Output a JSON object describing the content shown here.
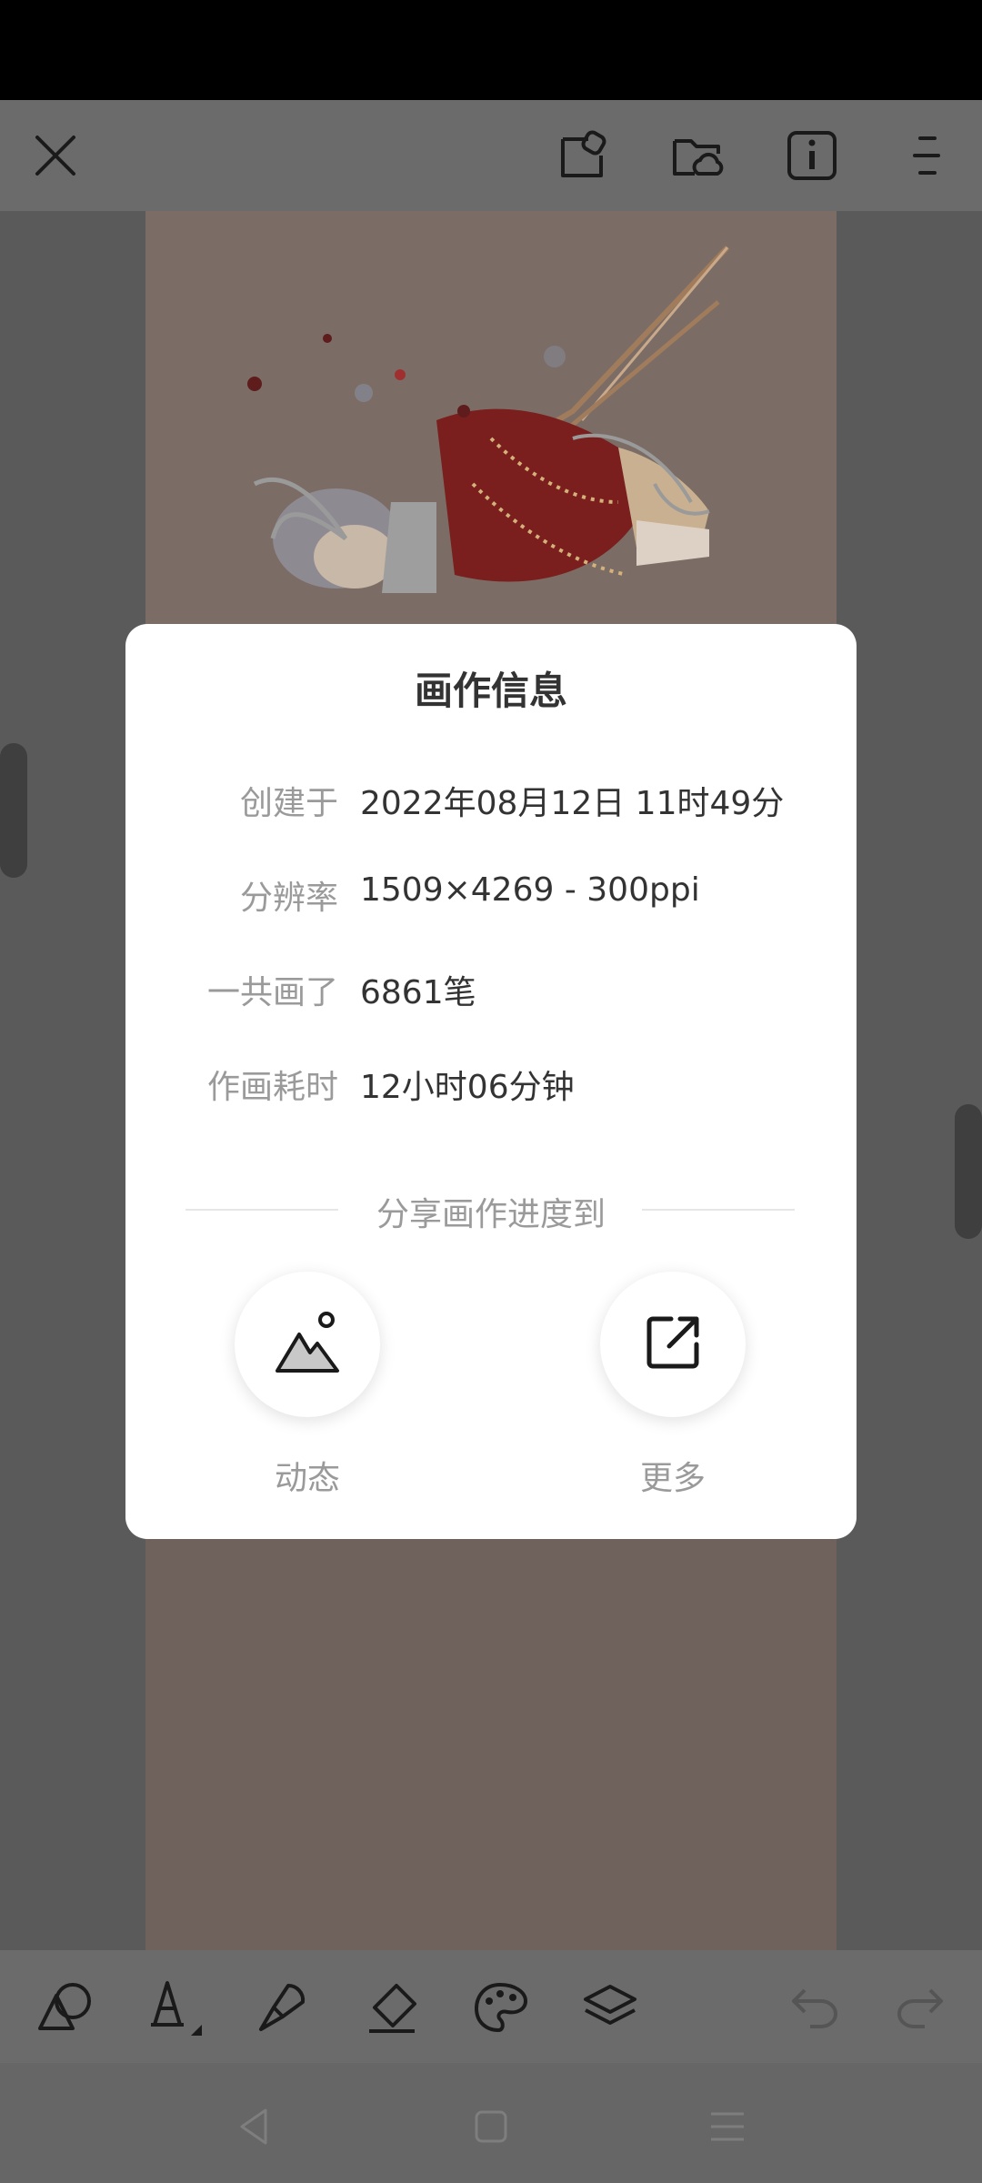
{
  "dialog": {
    "title": "画作信息",
    "rows": [
      {
        "label": "创建于",
        "value": "2022年08月12日 11时49分"
      },
      {
        "label": "分辨率",
        "value": "1509×4269 - 300ppi"
      },
      {
        "label": "一共画了",
        "value": "6861笔"
      },
      {
        "label": "作画耗时",
        "value": "12小时06分钟"
      }
    ],
    "share_caption": "分享画作进度到",
    "share_options": [
      {
        "label": "动态",
        "icon": "mountain-photo-icon"
      },
      {
        "label": "更多",
        "icon": "share-external-icon"
      }
    ]
  },
  "top_bar": {
    "icons": [
      "close-icon",
      "export-icon",
      "cloud-folder-icon",
      "info-icon",
      "menu-icon"
    ]
  },
  "bottom_toolbar": {
    "icons": [
      "shape-icon",
      "fill-bucket-icon",
      "brush-icon",
      "eraser-icon",
      "palette-icon",
      "layers-icon",
      "undo-icon",
      "redo-icon"
    ]
  },
  "nav_bar": {
    "icons": [
      "back-icon",
      "home-icon",
      "recents-icon"
    ]
  }
}
